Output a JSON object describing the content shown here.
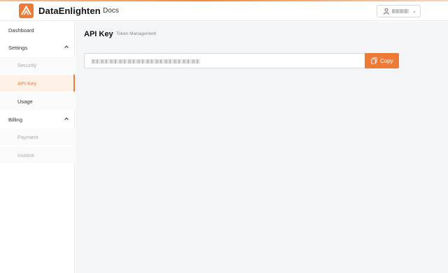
{
  "brand": {
    "name": "DataEnlighten",
    "accent": "#ee7b35"
  },
  "header": {
    "docs_label": "Docs",
    "user_icon": "user-icon"
  },
  "sidebar": {
    "items": [
      {
        "label": "Dashboard"
      },
      {
        "label": "Settings",
        "expanded": true
      },
      {
        "label": "Security"
      },
      {
        "label": "API Key",
        "active": true
      },
      {
        "label": "Usage"
      },
      {
        "label": "Billing",
        "expanded": true
      },
      {
        "label": "Payment"
      },
      {
        "label": "Invoice"
      }
    ]
  },
  "main": {
    "title": "API Key",
    "subtitle": "Token Management",
    "copy_label": "Copy",
    "copy_icon": "copy-icon"
  }
}
